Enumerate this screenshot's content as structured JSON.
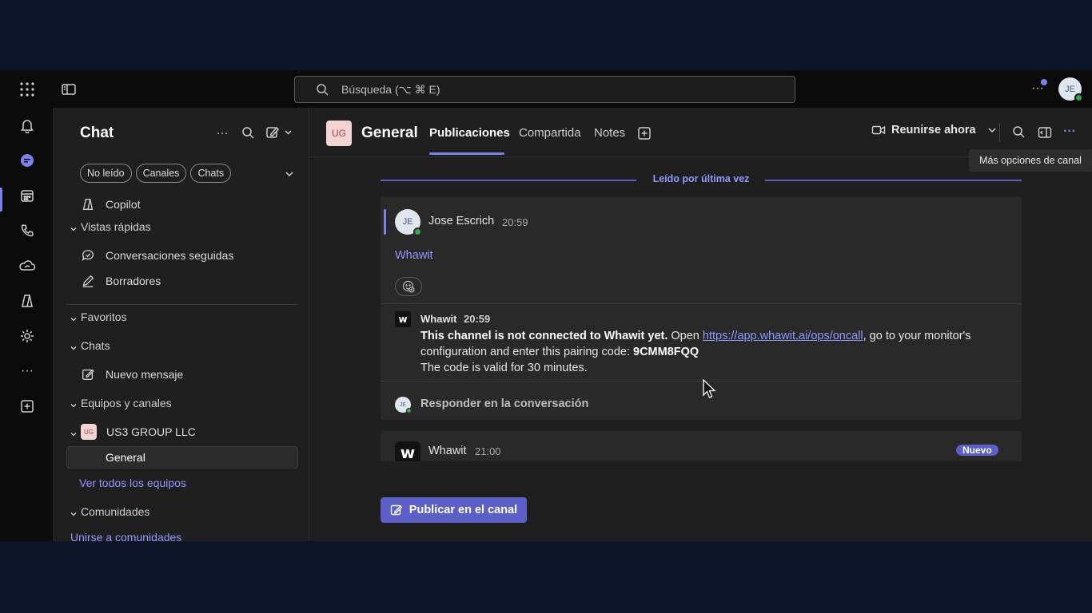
{
  "search": {
    "placeholder": "Búsqueda (⌥ ⌘ E)"
  },
  "user": {
    "initials": "JE"
  },
  "rail": [
    "bell-icon",
    "chat-icon",
    "calendar-icon",
    "calls-icon",
    "onedrive-icon",
    "copilot-icon",
    "apps-icon",
    "more-icon",
    "add-apps-icon"
  ],
  "left": {
    "title": "Chat",
    "filters": [
      "No leído",
      "Canales",
      "Chats"
    ],
    "copilot": "Copilot",
    "quick_views": "Vistas rápidas",
    "followed": "Conversaciones seguidas",
    "drafts": "Borradores",
    "favorites": "Favoritos",
    "chats": "Chats",
    "new_message": "Nuevo mensaje",
    "teams_channels": "Equipos y canales",
    "team_badge": "UG",
    "team_name": "US3 GROUP LLC",
    "channel": "General",
    "see_all_teams": "Ver todos los equipos",
    "communities": "Comunidades",
    "join_communities": "Unirse a comunidades"
  },
  "channel": {
    "badge": "UG",
    "title": "General",
    "tabs": [
      "Publicaciones",
      "Compartida",
      "Notes"
    ],
    "meet_now": "Reunirse ahora",
    "tooltip": "Más opciones de canal"
  },
  "feed": {
    "last_read": "Leído por última vez",
    "post": {
      "initials": "JE",
      "author": "Jose Escrich",
      "time": "20:59",
      "text": "Whawit"
    },
    "reply": {
      "logo": "w",
      "author": "Whawit",
      "time": "20:59",
      "bold_lead": "This channel is not connected to Whawit yet.",
      "open": " Open ",
      "url": "https://app.whawit.ai/ops/oncall",
      "after_url": ", go to your monitor's configuration and enter this pairing code: ",
      "code": "9CMM8FQQ",
      "valid": "The code is valid for 30 minutes."
    },
    "respond_initials": "JE",
    "respond": "Responder en la conversación",
    "next": {
      "logo": "w",
      "author": "Whawit",
      "time": "21:00",
      "badge": "Nuevo"
    },
    "post_button": "Publicar en el canal"
  },
  "colors": {
    "accent": "#5b5fc7",
    "link": "#8f98ff",
    "presence": "#34a853"
  }
}
